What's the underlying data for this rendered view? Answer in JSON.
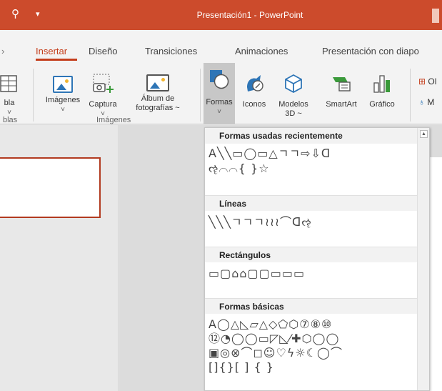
{
  "window": {
    "title": "Presentación1  -  PowerPoint"
  },
  "tabs": [
    {
      "label": "Insertar"
    },
    {
      "label": "Diseño"
    },
    {
      "label": "Transiciones"
    },
    {
      "label": "Animaciones"
    },
    {
      "label": "Presentación con diapo"
    }
  ],
  "ribbon": {
    "table": {
      "label": "bla"
    },
    "images": {
      "label": "Imágenes"
    },
    "screenshot": {
      "label": "Captura"
    },
    "album": {
      "label": "Álbum de",
      "label2": "fotografías ~"
    },
    "shapes": {
      "label": "Formas"
    },
    "icons": {
      "label": "Iconos"
    },
    "models3d": {
      "label": "Modelos",
      "label2": "3D ~"
    },
    "smartart": {
      "label": "SmartArt"
    },
    "chart": {
      "label": "Gráfico"
    },
    "right_partial_1": "Ol",
    "right_partial_2": "M",
    "caret": "˅",
    "group_tables": "blas",
    "group_images": "Imágenes"
  },
  "shapes_menu": {
    "sections": [
      {
        "title": "Formas usadas recientemente",
        "rows": [
          "A╲╲▭◯▭△ㄱㄱ⇨⇩ᗡ",
          "ૡ⌒⌒{ }☆"
        ]
      },
      {
        "title": "Líneas",
        "rows": [
          "╲╲╲ㄱㄱㄱ≀≀≀⌒ᗡૡ"
        ]
      },
      {
        "title": "Rectángulos",
        "rows": [
          "▭▢⌂⌂▢▢▭▭▭"
        ]
      },
      {
        "title": "Formas básicas",
        "rows": [
          "A◯△◺▱△◇⬠⬡⑦⑧⑩",
          "⑫◔◯◯▭◸◺⁄✚⬡◯◯",
          "▣◎⊗⌒◻☺♡ϟ☼☾◯⌒",
          "[]{}[  ]  {  }"
        ]
      }
    ]
  }
}
